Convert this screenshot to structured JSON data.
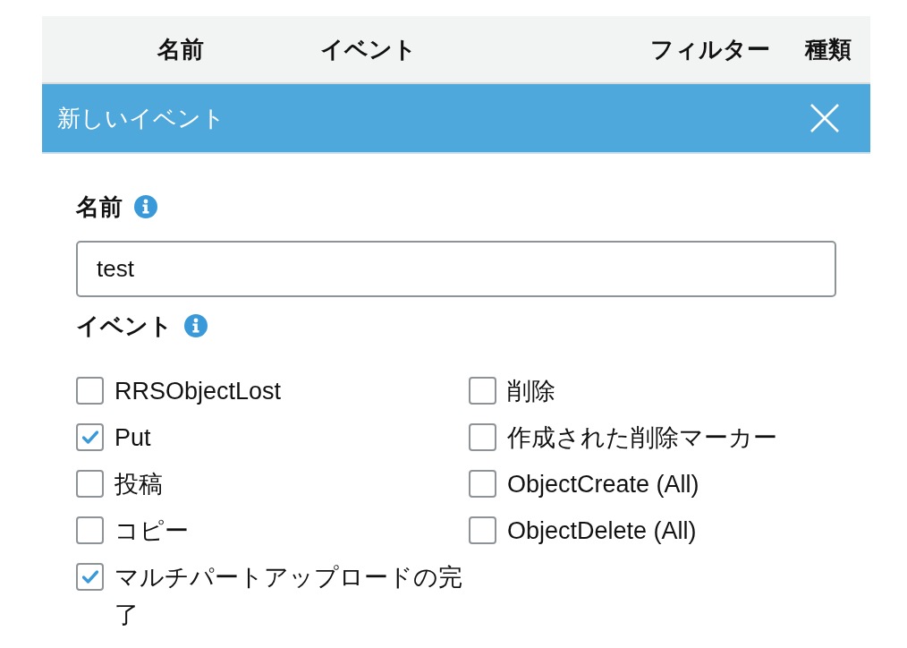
{
  "table": {
    "columns": [
      "名前",
      "イベント",
      "フィルター",
      "種類"
    ]
  },
  "panel": {
    "title": "新しいイベント"
  },
  "form": {
    "name": {
      "label": "名前",
      "value": "test"
    },
    "events": {
      "label": "イベント",
      "columns": [
        [
          {
            "label": "RRSObjectLost",
            "checked": false
          },
          {
            "label": "Put",
            "checked": true
          },
          {
            "label": "投稿",
            "checked": false
          },
          {
            "label": "コピー",
            "checked": false
          },
          {
            "label": "マルチパートアップロードの完了",
            "checked": true
          }
        ],
        [
          {
            "label": "削除",
            "checked": false
          },
          {
            "label": "作成された削除マーカー",
            "checked": false
          },
          {
            "label": "ObjectCreate (All)",
            "checked": false
          },
          {
            "label": "ObjectDelete (All)",
            "checked": false
          }
        ]
      ]
    }
  }
}
